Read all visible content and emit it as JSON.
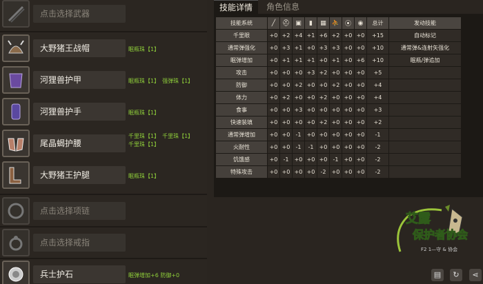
{
  "equipment": [
    {
      "name": "点击选择武器",
      "empty": true,
      "icon": "weapon-icon",
      "skills": []
    },
    {
      "name": "大野猪王战帽",
      "empty": false,
      "icon": "helmet-icon",
      "skills": [
        "眠瓶珠【1】"
      ]
    },
    {
      "name": "河狸兽护甲",
      "empty": false,
      "icon": "chest-armor-icon",
      "skills": [
        "眠瓶珠【1】",
        "强弹珠【1】"
      ]
    },
    {
      "name": "河狸兽护手",
      "empty": false,
      "icon": "gauntlet-icon",
      "skills": [
        "眠瓶珠【1】"
      ]
    },
    {
      "name": "尾晶蝎护腰",
      "empty": false,
      "icon": "waist-armor-icon",
      "skills": [
        "千里珠【1】",
        "千里珠【1】",
        "千里珠【1】"
      ]
    },
    {
      "name": "大野猪王护腿",
      "empty": false,
      "icon": "leg-armor-icon",
      "skills": [
        "眠瓶珠【1】"
      ]
    },
    {
      "name": "点击选择项链",
      "empty": true,
      "icon": "necklace-icon",
      "skills": []
    },
    {
      "name": "点击选择戒指",
      "empty": true,
      "icon": "ring-icon",
      "skills": []
    },
    {
      "name": "兵士护石",
      "empty": false,
      "icon": "charm-icon",
      "skills": [
        "眠弹增加+6 防御+0"
      ]
    }
  ],
  "tabs": {
    "active": "技能详情",
    "inactive": "角色信息"
  },
  "table": {
    "headers": {
      "system": "技能系统",
      "total": "总计",
      "active": "发动技能"
    },
    "column_icons": [
      "weapon-col-icon",
      "helmet-col-icon",
      "chest-col-icon",
      "arm-col-icon",
      "waist-col-icon",
      "leg-col-icon",
      "necklace-col-icon",
      "ring-col-icon"
    ],
    "rows": [
      {
        "system": "千里眼",
        "vals": [
          "+0",
          "+2",
          "+4",
          "+1",
          "+6",
          "+2",
          "+0",
          "+0"
        ],
        "total": "+15",
        "active": "自动标记"
      },
      {
        "system": "通常弹强化",
        "vals": [
          "+0",
          "+3",
          "+1",
          "+0",
          "+3",
          "+3",
          "+0",
          "+0"
        ],
        "total": "+10",
        "active": "通常弹&连射矢强化"
      },
      {
        "system": "眠弹增加",
        "vals": [
          "+0",
          "+1",
          "+1",
          "+1",
          "+0",
          "+1",
          "+0",
          "+6"
        ],
        "total": "+10",
        "active": "眠瓶/弹追加"
      },
      {
        "system": "攻击",
        "vals": [
          "+0",
          "+0",
          "+0",
          "+3",
          "+2",
          "+0",
          "+0",
          "+0"
        ],
        "total": "+5",
        "active": ""
      },
      {
        "system": "防御",
        "vals": [
          "+0",
          "+0",
          "+2",
          "+0",
          "+0",
          "+2",
          "+0",
          "+0"
        ],
        "total": "+4",
        "active": ""
      },
      {
        "system": "体力",
        "vals": [
          "+0",
          "+2",
          "+0",
          "+0",
          "+2",
          "+0",
          "+0",
          "+0"
        ],
        "total": "+4",
        "active": ""
      },
      {
        "system": "食事",
        "vals": [
          "+0",
          "+0",
          "+3",
          "+0",
          "+0",
          "+0",
          "+0",
          "+0"
        ],
        "total": "+3",
        "active": ""
      },
      {
        "system": "快速装填",
        "vals": [
          "+0",
          "+0",
          "+0",
          "+0",
          "+2",
          "+0",
          "+0",
          "+0"
        ],
        "total": "+2",
        "active": ""
      },
      {
        "system": "通常弹增加",
        "vals": [
          "+0",
          "+0",
          "-1",
          "+0",
          "+0",
          "+0",
          "+0",
          "+0"
        ],
        "total": "-1",
        "active": ""
      },
      {
        "system": "火耐性",
        "vals": [
          "+0",
          "+0",
          "-1",
          "-1",
          "+0",
          "+0",
          "+0",
          "+0"
        ],
        "total": "-2",
        "active": ""
      },
      {
        "system": "饥饿感",
        "vals": [
          "+0",
          "-1",
          "+0",
          "+0",
          "+0",
          "-1",
          "+0",
          "+0"
        ],
        "total": "-2",
        "active": ""
      },
      {
        "system": "特殊攻击",
        "vals": [
          "+0",
          "+0",
          "+0",
          "+0",
          "-2",
          "+0",
          "+0",
          "+0"
        ],
        "total": "-2",
        "active": ""
      }
    ]
  },
  "logo": {
    "line1": "艾露",
    "line2": "保护者协会",
    "line3": "F2 1—守 & 协会"
  },
  "buttons": [
    {
      "icon": "save-icon",
      "glyph": "▤"
    },
    {
      "icon": "refresh-icon",
      "glyph": "↻"
    },
    {
      "icon": "share-icon",
      "glyph": "⋖"
    }
  ]
}
